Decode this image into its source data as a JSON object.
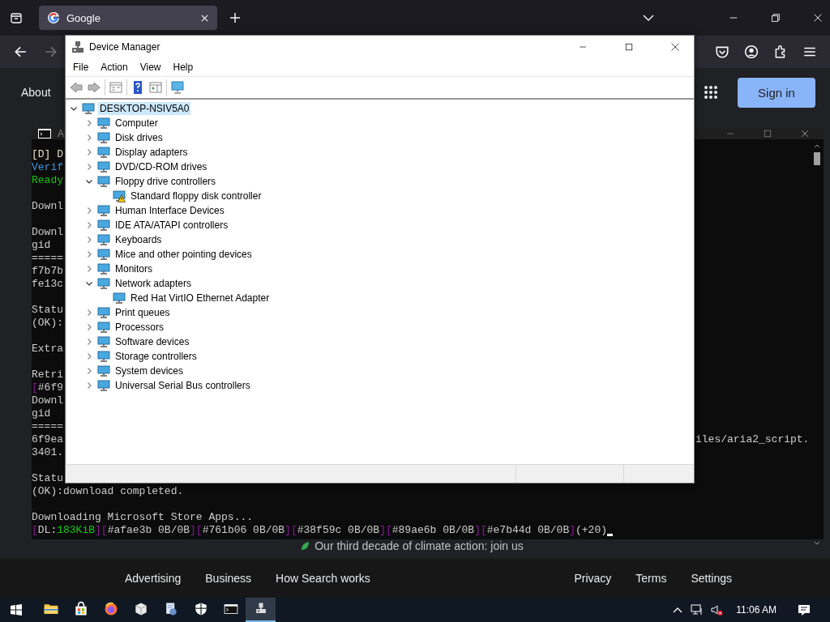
{
  "browser": {
    "tab": {
      "title": "Google",
      "selected": true
    },
    "back_disabled": false,
    "forward_disabled": true
  },
  "google": {
    "about": "About",
    "sign_in": "Sign in",
    "climate": "Our third decade of climate action: join us",
    "footer_left": [
      "Advertising",
      "Business",
      "How Search works"
    ],
    "footer_right": [
      "Privacy",
      "Terms",
      "Settings"
    ]
  },
  "console": {
    "title": "A",
    "blocks": [
      [
        {
          "text": "[D] D",
          "color": "#e8e4c8"
        },
        {
          "text": "Verif",
          "color": "#3a96dd"
        },
        {
          "text": "Ready",
          "color": "#16c60c"
        }
      ],
      [
        {
          "text": "Downl",
          "color": "#cccccc"
        }
      ],
      [
        {
          "text": "Downl",
          "color": "#cccccc"
        },
        {
          "text": "gid",
          "color": "#cccccc"
        },
        {
          "text": "=====",
          "color": "#cccccc"
        },
        {
          "text": "f7b7b",
          "color": "#cccccc"
        },
        {
          "text": "fe13c",
          "color": "#cccccc"
        }
      ],
      [
        {
          "text": "Statu",
          "color": "#cccccc"
        },
        {
          "text": "(OK):",
          "color": "#cccccc"
        }
      ],
      [
        {
          "text": "Extra",
          "color": "#cccccc"
        }
      ],
      [
        {
          "text": "Retri",
          "color": "#cccccc"
        },
        {
          "segments": [
            {
              "text": "[",
              "color": "#881798"
            },
            {
              "text": "#6f9",
              "color": "#cccccc"
            }
          ]
        },
        {
          "text": "Downl",
          "color": "#cccccc"
        },
        {
          "text": "gid",
          "color": "#cccccc"
        },
        {
          "text": "=====",
          "color": "#cccccc"
        },
        {
          "text": "6f9ea",
          "color": "#cccccc",
          "right": "iles/aria2_script."
        },
        {
          "text": "3401.",
          "color": "#cccccc"
        }
      ],
      [
        {
          "text": "Statu",
          "color": "#cccccc"
        },
        {
          "text": "(OK):download completed.",
          "color": "#cccccc"
        }
      ],
      [
        {
          "text": "Downloading Microsoft Store Apps...",
          "color": "#cccccc"
        },
        {
          "segments": [
            {
              "text": "[",
              "color": "#881798"
            },
            {
              "text": "DL:",
              "color": "#cccccc"
            },
            {
              "text": "183KiB",
              "color": "#16c60c"
            },
            {
              "text": "][",
              "color": "#881798"
            },
            {
              "text": "#afae3b 0B/0B",
              "color": "#cccccc"
            },
            {
              "text": "][",
              "color": "#881798"
            },
            {
              "text": "#761b06 0B/0B",
              "color": "#cccccc"
            },
            {
              "text": "][",
              "color": "#881798"
            },
            {
              "text": "#38f59c 0B/0B",
              "color": "#cccccc"
            },
            {
              "text": "][",
              "color": "#881798"
            },
            {
              "text": "#89ae6b 0B/0B",
              "color": "#cccccc"
            },
            {
              "text": "][",
              "color": "#881798"
            },
            {
              "text": "#e7b44d 0B/0B",
              "color": "#cccccc"
            },
            {
              "text": "]",
              "color": "#881798"
            },
            {
              "text": "(+20)",
              "color": "#cccccc"
            }
          ],
          "cursor": true
        }
      ]
    ]
  },
  "device_manager": {
    "title": "Device Manager",
    "menu": [
      "File",
      "Action",
      "View",
      "Help"
    ],
    "tree": {
      "label": "DESKTOP-NSIV5A0",
      "expanded": true,
      "selected": true,
      "children": [
        {
          "label": "Computer",
          "expanded": false,
          "selected": false
        },
        {
          "label": "Disk drives",
          "expanded": false,
          "selected": false
        },
        {
          "label": "Display adapters",
          "expanded": false,
          "selected": false
        },
        {
          "label": "DVD/CD-ROM drives",
          "expanded": false,
          "selected": false
        },
        {
          "label": "Floppy drive controllers",
          "expanded": true,
          "selected": false,
          "children": [
            {
              "label": "Standard floppy disk controller",
              "selected": false,
              "warning": true
            }
          ]
        },
        {
          "label": "Human Interface Devices",
          "expanded": false,
          "selected": false
        },
        {
          "label": "IDE ATA/ATAPI controllers",
          "expanded": false,
          "selected": false
        },
        {
          "label": "Keyboards",
          "expanded": false,
          "selected": false
        },
        {
          "label": "Mice and other pointing devices",
          "expanded": false,
          "selected": false
        },
        {
          "label": "Monitors",
          "expanded": false,
          "selected": false
        },
        {
          "label": "Network adapters",
          "expanded": true,
          "selected": false,
          "children": [
            {
              "label": "Red Hat VirtIO Ethernet Adapter",
              "selected": false,
              "warning": false
            }
          ]
        },
        {
          "label": "Print queues",
          "expanded": false,
          "selected": false
        },
        {
          "label": "Processors",
          "expanded": false,
          "selected": false
        },
        {
          "label": "Software devices",
          "expanded": false,
          "selected": false
        },
        {
          "label": "Storage controllers",
          "expanded": false,
          "selected": false
        },
        {
          "label": "System devices",
          "expanded": false,
          "selected": false
        },
        {
          "label": "Universal Serial Bus controllers",
          "expanded": false,
          "selected": false
        }
      ]
    }
  },
  "taskbar": {
    "apps": [
      {
        "selected": false
      },
      {
        "selected": false
      },
      {
        "selected": false
      },
      {
        "selected": false
      },
      {
        "selected": false
      },
      {
        "selected": false
      },
      {
        "selected": false
      },
      {
        "selected": true
      }
    ],
    "time": "11:06 AM"
  }
}
